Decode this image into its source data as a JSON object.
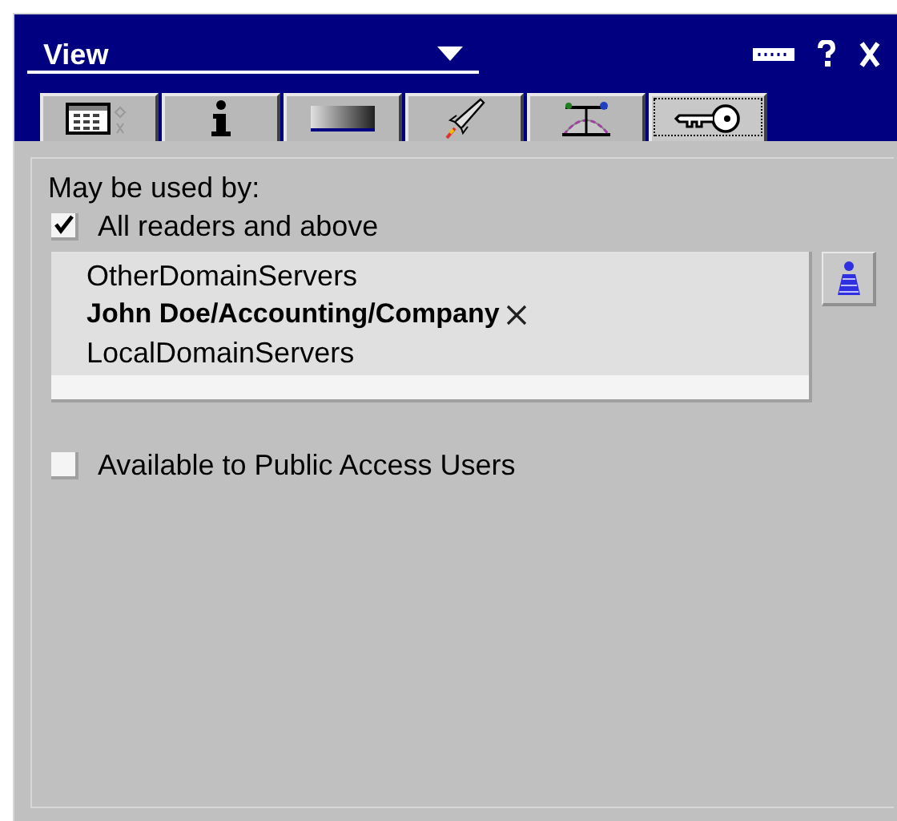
{
  "window": {
    "title": "View"
  },
  "tabs": [
    {
      "selected": false
    },
    {
      "selected": false
    },
    {
      "selected": false
    },
    {
      "selected": false
    },
    {
      "selected": false
    },
    {
      "selected": true
    }
  ],
  "access": {
    "label": "May be used by:",
    "all_readers": {
      "label": "All readers and above",
      "checked": true
    },
    "names": [
      {
        "text": "OtherDomainServers",
        "bold": false,
        "removable": false
      },
      {
        "text": "John Doe/Accounting/Company",
        "bold": true,
        "removable": true
      },
      {
        "text": "LocalDomainServers",
        "bold": false,
        "removable": false
      }
    ],
    "public_access": {
      "label": "Available to Public Access Users",
      "checked": false
    }
  }
}
